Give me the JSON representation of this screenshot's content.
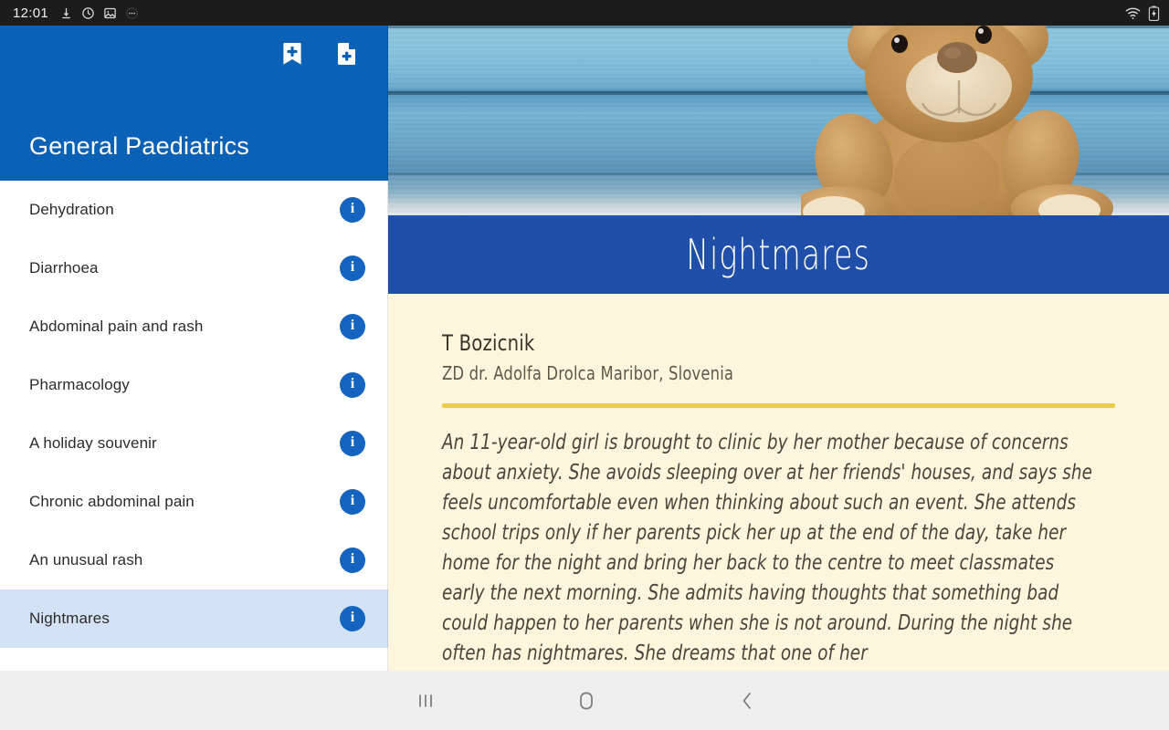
{
  "status_bar": {
    "time": "12:01",
    "left_icons": [
      "download-icon",
      "sync-icon",
      "image-icon",
      "more-icon"
    ],
    "right_icons": [
      "wifi-icon",
      "battery-charging-icon"
    ]
  },
  "sidebar": {
    "app_title": "General Paediatrics",
    "header_color": "#0b61b6",
    "actions": [
      {
        "name": "add-bookmark-button",
        "icon": "bookmark-add-icon"
      },
      {
        "name": "add-note-button",
        "icon": "note-add-icon"
      }
    ],
    "selected_index": 7,
    "info_icon_label": "i",
    "items": [
      {
        "label": "Dehydration"
      },
      {
        "label": "Diarrhoea"
      },
      {
        "label": "Abdominal pain and rash"
      },
      {
        "label": "Pharmacology"
      },
      {
        "label": "A holiday souvenir"
      },
      {
        "label": "Chronic abdominal pain"
      },
      {
        "label": "An unusual rash"
      },
      {
        "label": "Nightmares"
      }
    ]
  },
  "content": {
    "hero_image_alt": "teddy-bear-on-blue-wooden-planks",
    "banner_title": "Nightmares",
    "banner_color": "#1f4fa8",
    "background_color": "#fdf6dd",
    "rule_color": "#e9cd45",
    "author": "T Bozicnik",
    "affiliation": "ZD dr. Adolfa Drolca Maribor, Slovenia",
    "body": "An 11-year-old girl is brought to clinic by her mother because of concerns about anxiety. She avoids sleeping over at her friends' houses, and says she feels uncomfortable even when thinking about such an event. She attends school trips only if her parents pick her up at the end of the day, take her home for the night and bring her back to the centre to meet classmates early the next morning. She admits having thoughts that something bad could happen to her parents when she is not around. During the night she often has nightmares. She dreams that one of her"
  },
  "nav_bar": {
    "buttons": [
      {
        "name": "recents-button",
        "icon": "recents-icon"
      },
      {
        "name": "home-button",
        "icon": "home-icon"
      },
      {
        "name": "back-button",
        "icon": "back-icon"
      }
    ]
  }
}
